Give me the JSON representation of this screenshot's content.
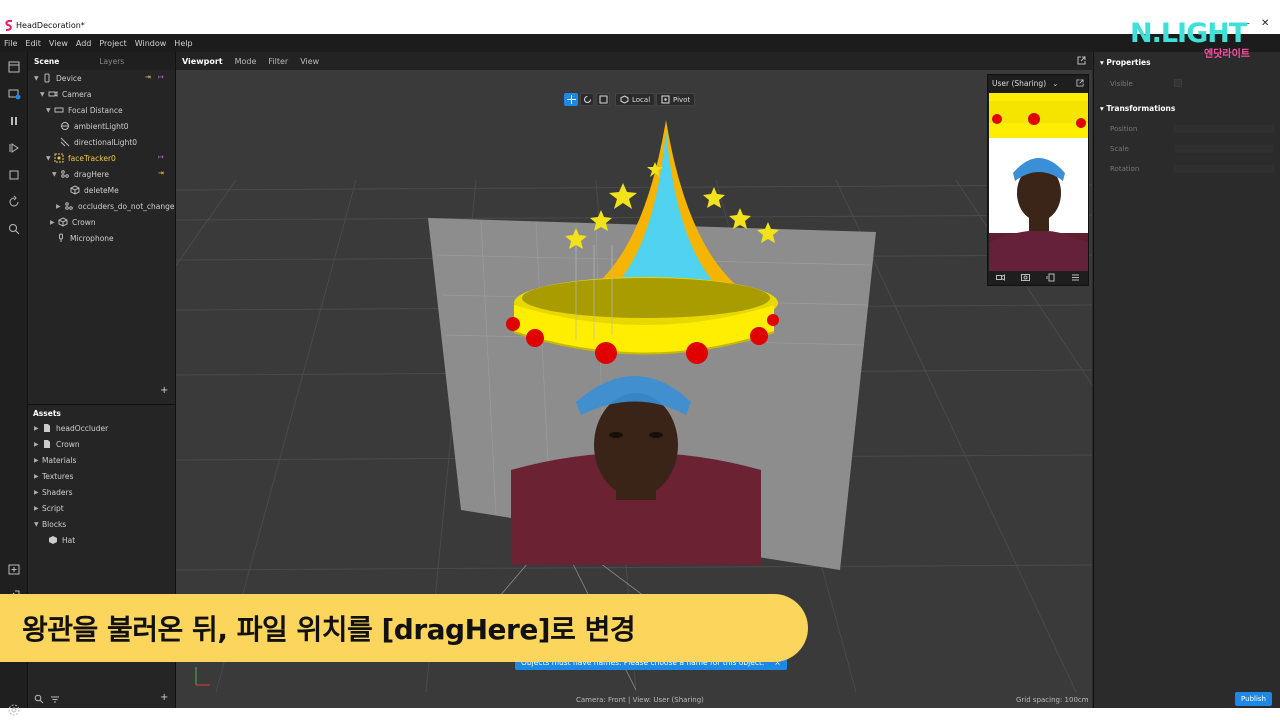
{
  "window": {
    "title": "HeadDecoration*",
    "minimize": "—",
    "close": "✕"
  },
  "brand": {
    "logo_text": "N.LIGHT",
    "logo_sub": "엔닷라이트"
  },
  "menu": [
    "File",
    "Edit",
    "View",
    "Add",
    "Project",
    "Window",
    "Help"
  ],
  "left_panel": {
    "tabs": [
      "Scene",
      "Layers"
    ],
    "scene_tree": [
      {
        "label": "Device",
        "depth": 0,
        "expanded": true
      },
      {
        "label": "Camera",
        "depth": 1,
        "expanded": true
      },
      {
        "label": "Focal Distance",
        "depth": 2,
        "expanded": true
      },
      {
        "label": "ambientLight0",
        "depth": 3
      },
      {
        "label": "directionalLight0",
        "depth": 3
      },
      {
        "label": "faceTracker0",
        "depth": 3,
        "highlight": true
      },
      {
        "label": "dragHere",
        "depth": 3
      },
      {
        "label": "deleteMe",
        "depth": 4
      },
      {
        "label": "occluders_do_not_change",
        "depth": 4
      },
      {
        "label": "Crown",
        "depth": 3
      },
      {
        "label": "Microphone",
        "depth": 2
      }
    ],
    "add_symbol": "+",
    "assets_title": "Assets",
    "assets": [
      {
        "label": "headOccluder"
      },
      {
        "label": "Crown"
      },
      {
        "label": "Materials"
      },
      {
        "label": "Textures"
      },
      {
        "label": "Shaders"
      },
      {
        "label": "Script"
      },
      {
        "label": "Blocks"
      },
      {
        "label": "Hat"
      }
    ]
  },
  "viewport": {
    "tabs": [
      "Viewport",
      "Mode",
      "Filter",
      "View"
    ],
    "tools": {
      "local": "Local",
      "pivot": "Pivot"
    },
    "preview_title": "User (Sharing)",
    "status_camera": "Camera: Front | View: User (Sharing)",
    "grid_spacing": "Grid spacing: 100cm",
    "toast": "Objects must have names. Please choose a name for this object.",
    "toast_close": "×"
  },
  "right_panel": {
    "properties": "Properties",
    "visible": "Visible",
    "transformations": "Transformations",
    "position": "Position",
    "scale": "Scale",
    "rotation": "Rotation",
    "publish": "Publish"
  },
  "caption": "왕관을 불러온 뒤, 파일 위치를 [dragHere]로 변경",
  "colors": {
    "accent": "#1e88e5",
    "caption_bg": "#fbd55c",
    "crown": "#ffee00",
    "gem": "#e00000",
    "cone": "#4fd3f0"
  }
}
